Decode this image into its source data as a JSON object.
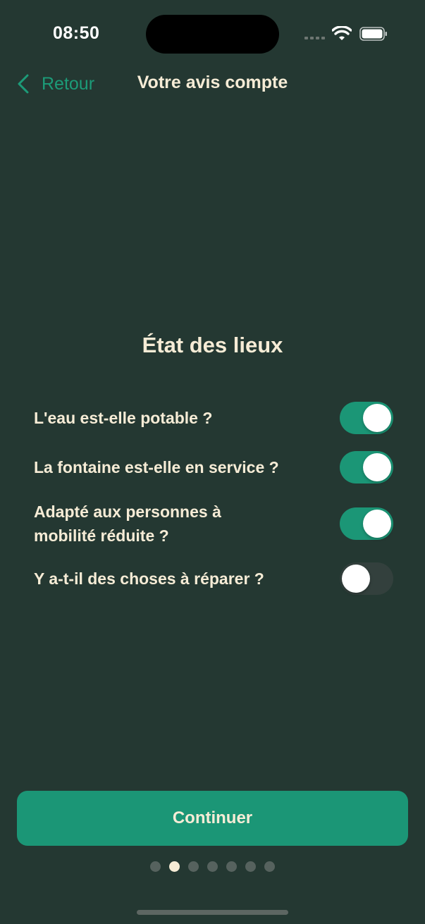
{
  "status_bar": {
    "time": "08:50"
  },
  "nav": {
    "back_label": "Retour",
    "title": "Votre avis compte"
  },
  "section": {
    "title": "État des lieux"
  },
  "questions": [
    {
      "label": "L'eau est-elle potable ?",
      "enabled": true
    },
    {
      "label": "La fontaine est-elle en service ?",
      "enabled": true
    },
    {
      "label": "Adapté aux personnes à mobilité réduite ?",
      "enabled": true
    },
    {
      "label": "Y a-t-il des choses à réparer ?",
      "enabled": false
    }
  ],
  "continue_label": "Continuer",
  "pagination": {
    "total": 7,
    "current": 2
  },
  "colors": {
    "background": "#243832",
    "accent": "#1b9676",
    "text": "#f6ecd6",
    "toggle_off": "#33403d"
  }
}
